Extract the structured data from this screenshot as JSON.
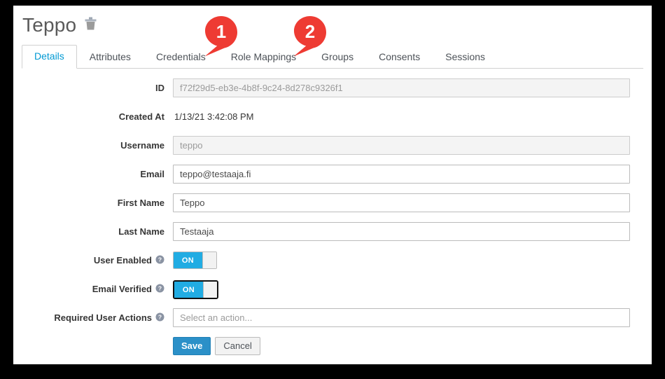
{
  "header": {
    "title": "Teppo",
    "delete_icon": "trash-icon"
  },
  "tabs": [
    {
      "label": "Details",
      "active": true
    },
    {
      "label": "Attributes",
      "active": false
    },
    {
      "label": "Credentials",
      "active": false
    },
    {
      "label": "Role Mappings",
      "active": false
    },
    {
      "label": "Groups",
      "active": false
    },
    {
      "label": "Consents",
      "active": false
    },
    {
      "label": "Sessions",
      "active": false
    }
  ],
  "form": {
    "id": {
      "label": "ID",
      "value": "f72f29d5-eb3e-4b8f-9c24-8d278c9326f1"
    },
    "created_at": {
      "label": "Created At",
      "value": "1/13/21 3:42:08 PM"
    },
    "username": {
      "label": "Username",
      "value": "teppo"
    },
    "email": {
      "label": "Email",
      "value": "teppo@testaaja.fi"
    },
    "first_name": {
      "label": "First Name",
      "value": "Teppo"
    },
    "last_name": {
      "label": "Last Name",
      "value": "Testaaja"
    },
    "user_enabled": {
      "label": "User Enabled",
      "state": "ON",
      "help_icon": "help-circle-icon"
    },
    "email_verified": {
      "label": "Email Verified",
      "state": "ON",
      "help_icon": "help-circle-icon"
    },
    "required_user_actions": {
      "label": "Required User Actions",
      "placeholder": "Select an action...",
      "value": "",
      "help_icon": "help-circle-icon"
    }
  },
  "buttons": {
    "save": "Save",
    "cancel": "Cancel"
  },
  "callouts": [
    {
      "number": "1"
    },
    {
      "number": "2"
    }
  ],
  "colors": {
    "accent_blue": "#0099d3",
    "toggle_on": "#21ace3",
    "save_button": "#2b90c8",
    "callout_red": "#ee3b33",
    "title_grey": "#5a5a5a"
  }
}
